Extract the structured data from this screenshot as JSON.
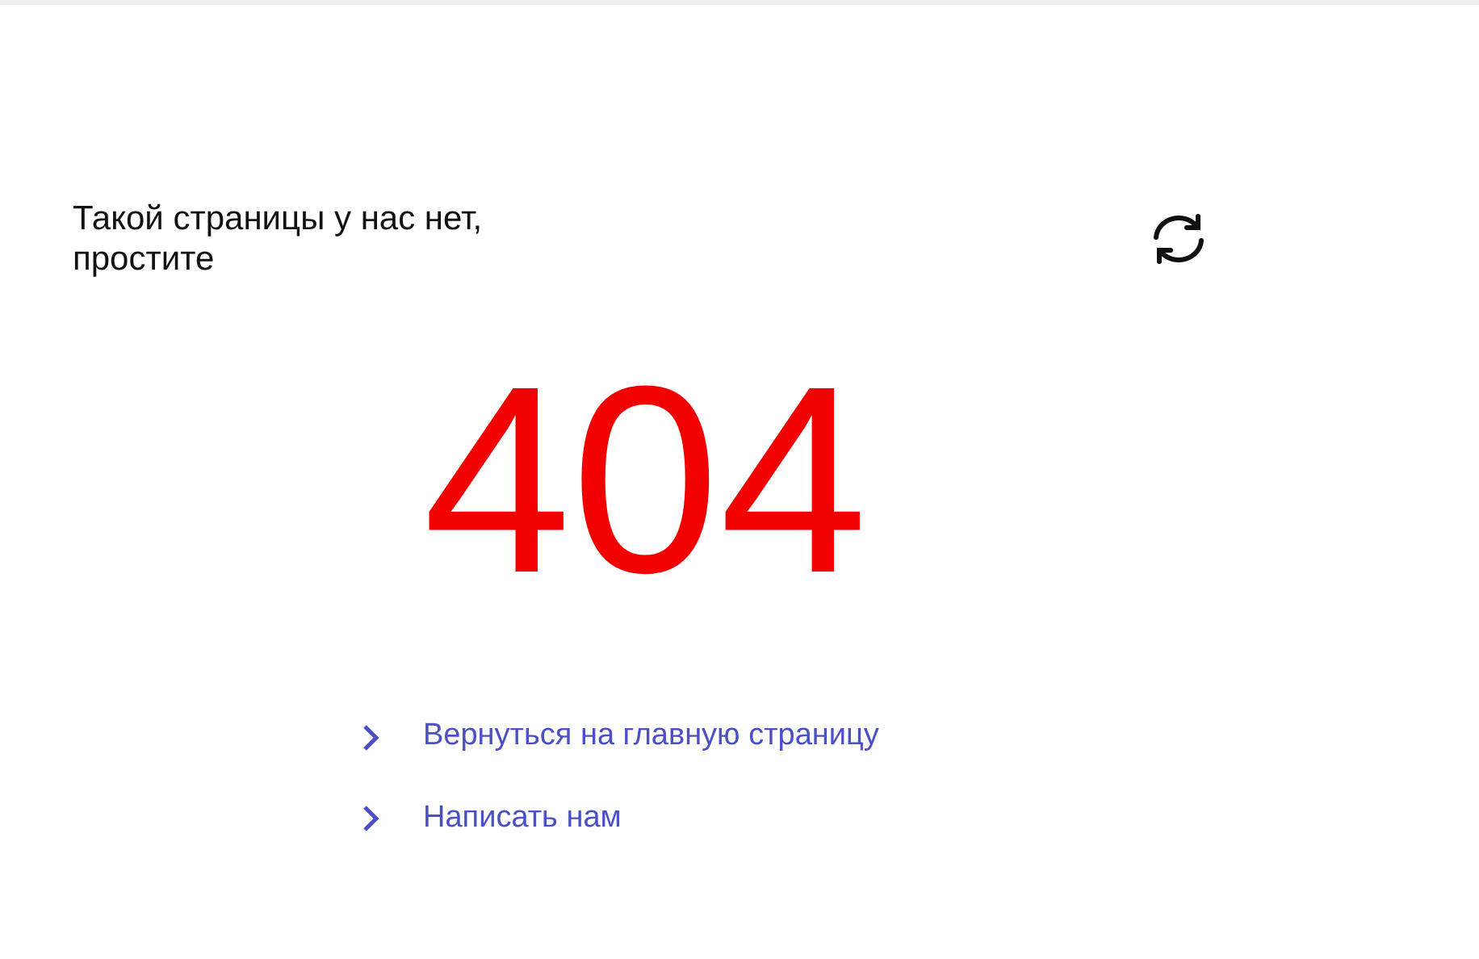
{
  "title": "Такой страницы у нас нет, простите",
  "code": "404",
  "links": [
    {
      "label": "Вернуться на главную страницу"
    },
    {
      "label": "Написать нам"
    }
  ]
}
